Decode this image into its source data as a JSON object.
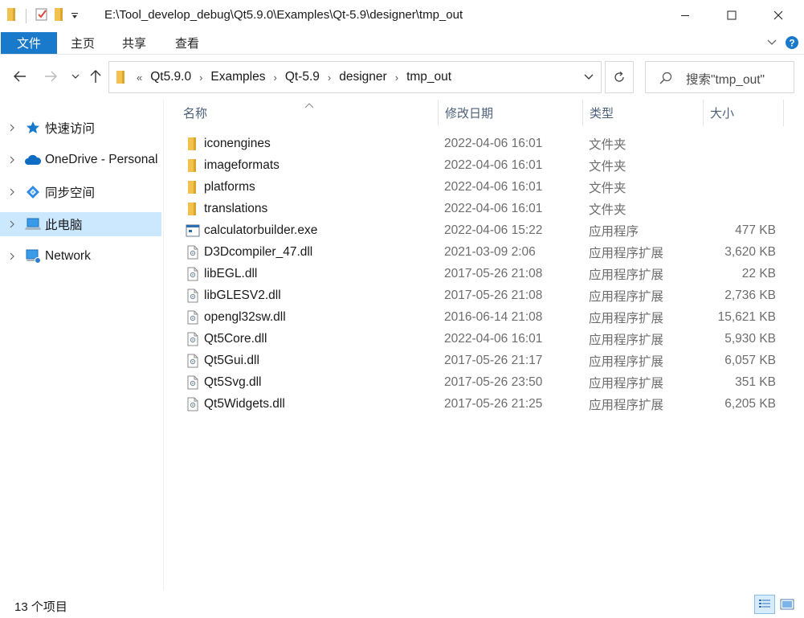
{
  "window": {
    "title": "E:\\Tool_develop_debug\\Qt5.9.0\\Examples\\Qt-5.9\\designer\\tmp_out"
  },
  "ribbon": {
    "file": "文件",
    "home": "主页",
    "share": "共享",
    "view": "查看"
  },
  "address": {
    "overflow": "«",
    "crumbs": [
      "Qt5.9.0",
      "Examples",
      "Qt-5.9",
      "designer",
      "tmp_out"
    ]
  },
  "search": {
    "placeholder": "搜索\"tmp_out\""
  },
  "nav": {
    "items": [
      {
        "label": "快速访问",
        "icon": "star-icon"
      },
      {
        "label": "OneDrive - Personal",
        "icon": "cloud-icon"
      },
      {
        "label": "同步空间",
        "icon": "sync-space-icon"
      },
      {
        "label": "此电脑",
        "icon": "computer-icon",
        "selected": true
      },
      {
        "label": "Network",
        "icon": "network-icon"
      }
    ]
  },
  "columns": {
    "name": "名称",
    "date": "修改日期",
    "type": "类型",
    "size": "大小"
  },
  "files": [
    {
      "name": "iconengines",
      "date": "2022-04-06 16:01",
      "type": "文件夹",
      "size": "",
      "icon": "folder-icon"
    },
    {
      "name": "imageformats",
      "date": "2022-04-06 16:01",
      "type": "文件夹",
      "size": "",
      "icon": "folder-icon"
    },
    {
      "name": "platforms",
      "date": "2022-04-06 16:01",
      "type": "文件夹",
      "size": "",
      "icon": "folder-icon"
    },
    {
      "name": "translations",
      "date": "2022-04-06 16:01",
      "type": "文件夹",
      "size": "",
      "icon": "folder-icon"
    },
    {
      "name": "calculatorbuilder.exe",
      "date": "2022-04-06 15:22",
      "type": "应用程序",
      "size": "477 KB",
      "icon": "exe-icon"
    },
    {
      "name": "D3Dcompiler_47.dll",
      "date": "2021-03-09 2:06",
      "type": "应用程序扩展",
      "size": "3,620 KB",
      "icon": "dll-icon"
    },
    {
      "name": "libEGL.dll",
      "date": "2017-05-26 21:08",
      "type": "应用程序扩展",
      "size": "22 KB",
      "icon": "dll-icon"
    },
    {
      "name": "libGLESV2.dll",
      "date": "2017-05-26 21:08",
      "type": "应用程序扩展",
      "size": "2,736 KB",
      "icon": "dll-icon"
    },
    {
      "name": "opengl32sw.dll",
      "date": "2016-06-14 21:08",
      "type": "应用程序扩展",
      "size": "15,621 KB",
      "icon": "dll-icon"
    },
    {
      "name": "Qt5Core.dll",
      "date": "2022-04-06 16:01",
      "type": "应用程序扩展",
      "size": "5,930 KB",
      "icon": "dll-icon"
    },
    {
      "name": "Qt5Gui.dll",
      "date": "2017-05-26 21:17",
      "type": "应用程序扩展",
      "size": "6,057 KB",
      "icon": "dll-icon"
    },
    {
      "name": "Qt5Svg.dll",
      "date": "2017-05-26 23:50",
      "type": "应用程序扩展",
      "size": "351 KB",
      "icon": "dll-icon"
    },
    {
      "name": "Qt5Widgets.dll",
      "date": "2017-05-26 21:25",
      "type": "应用程序扩展",
      "size": "6,205 KB",
      "icon": "dll-icon"
    }
  ],
  "status": {
    "count": "13 个项目"
  },
  "colors": {
    "accent": "#1979ca",
    "selection": "#cce8ff",
    "folder": "#f2c14e"
  }
}
